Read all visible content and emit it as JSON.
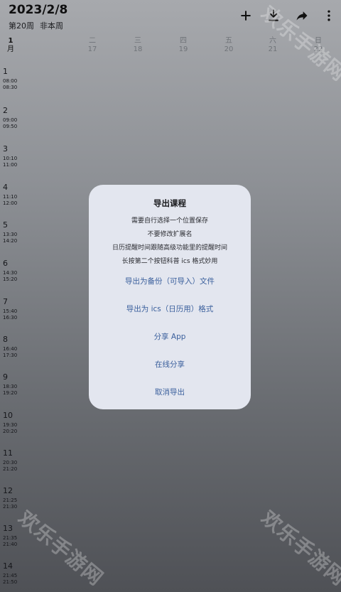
{
  "header": {
    "date": "2023/2/8",
    "week_label": "第20周",
    "week_status": "非本周"
  },
  "toolbar": {
    "add_icon": "plus-icon",
    "download_icon": "download-icon",
    "share_icon": "share-arrow-icon",
    "more_icon": "more-vertical-icon"
  },
  "month": {
    "number": "1",
    "unit": "月"
  },
  "days": [
    {
      "weekday": "二",
      "date": "17"
    },
    {
      "weekday": "三",
      "date": "18"
    },
    {
      "weekday": "四",
      "date": "19"
    },
    {
      "weekday": "五",
      "date": "20"
    },
    {
      "weekday": "六",
      "date": "21"
    },
    {
      "weekday": "日",
      "date": "22"
    }
  ],
  "slots": [
    {
      "n": "1",
      "start": "08:00",
      "end": "08:30"
    },
    {
      "n": "2",
      "start": "09:00",
      "end": "09:50"
    },
    {
      "n": "3",
      "start": "10:10",
      "end": "11:00"
    },
    {
      "n": "4",
      "start": "11:10",
      "end": "12:00"
    },
    {
      "n": "5",
      "start": "13:30",
      "end": "14:20"
    },
    {
      "n": "6",
      "start": "14:30",
      "end": "15:20"
    },
    {
      "n": "7",
      "start": "15:40",
      "end": "16:30"
    },
    {
      "n": "8",
      "start": "16:40",
      "end": "17:30"
    },
    {
      "n": "9",
      "start": "18:30",
      "end": "19:20"
    },
    {
      "n": "10",
      "start": "19:30",
      "end": "20:20"
    },
    {
      "n": "11",
      "start": "20:30",
      "end": "21:20"
    },
    {
      "n": "12",
      "start": "21:25",
      "end": "21:30"
    },
    {
      "n": "13",
      "start": "21:35",
      "end": "21:40"
    },
    {
      "n": "14",
      "start": "21:45",
      "end": "21:50"
    }
  ],
  "dialog": {
    "title": "导出课程",
    "messages": [
      "需要自行选择一个位置保存",
      "不要修改扩展名",
      "日历提醒时间跟随高级功能里的提醒时间",
      "长按第二个按钮科普 ics 格式妙用"
    ],
    "options": [
      "导出为备份（可导入）文件",
      "导出为 ics（日历用）格式",
      "分享 App",
      "在线分享",
      "取消导出"
    ]
  },
  "watermark": "欢乐手游网"
}
